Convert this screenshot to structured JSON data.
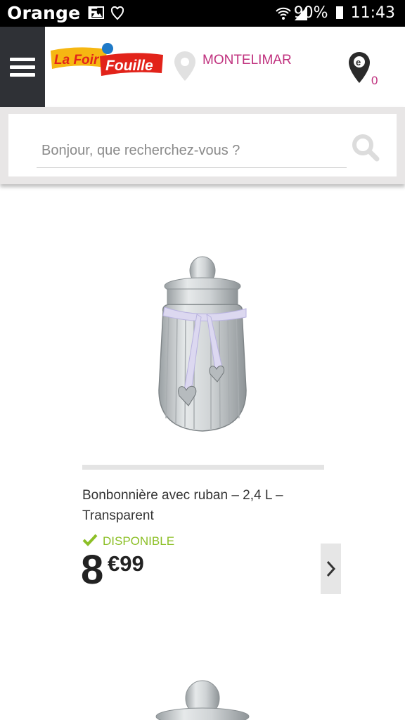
{
  "status_bar": {
    "carrier": "Orange F",
    "battery": "90%",
    "time": "11:43"
  },
  "header": {
    "store": "MONTELIMAR",
    "cart_count": "0",
    "logo_top": "La Foir",
    "logo_bottom": "Fouille"
  },
  "search": {
    "placeholder": "Bonjour, que recherchez-vous ?"
  },
  "product": {
    "title": "Bonbonnière avec ruban – 2,4 L – Transparent",
    "availability": "DISPONIBLE",
    "price_int": "8",
    "price_dec": "€99"
  },
  "colors": {
    "accent": "#c0317e",
    "available": "#8cbf26",
    "menu_bg": "#2f3136"
  }
}
